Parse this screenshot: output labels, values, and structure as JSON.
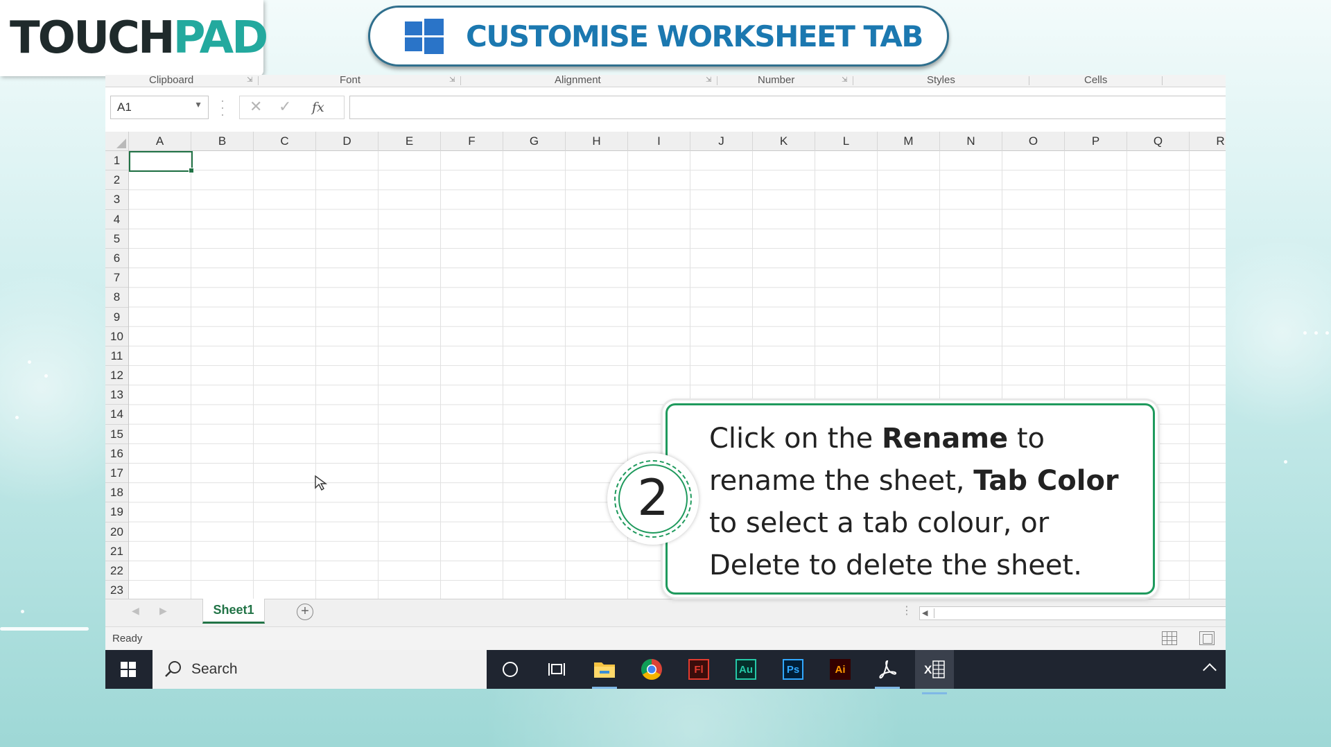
{
  "brand": {
    "logo_part1": "TOUCH",
    "logo_part2": "PAD",
    "accent": "#23a99e",
    "dark": "#1f2a2b"
  },
  "title": {
    "text": "CUSTOMISE WORKSHEET TAB",
    "color": "#1b78b0",
    "icon": "windows-logo-icon"
  },
  "ribbon": {
    "groups": [
      "Clipboard",
      "Font",
      "Alignment",
      "Number",
      "Styles",
      "Cells"
    ]
  },
  "formula_bar": {
    "name_box": "A1",
    "cancel_glyph": "✕",
    "enter_glyph": "✓",
    "fx_glyph": "fx",
    "formula_value": ""
  },
  "grid": {
    "columns": [
      "A",
      "B",
      "C",
      "D",
      "E",
      "F",
      "G",
      "H",
      "I",
      "J",
      "K",
      "L",
      "M",
      "N",
      "O",
      "P",
      "Q",
      "R"
    ],
    "rows": [
      "1",
      "2",
      "3",
      "4",
      "5",
      "6",
      "7",
      "8",
      "9",
      "10",
      "11",
      "12",
      "13",
      "14",
      "15",
      "16",
      "17",
      "18",
      "19",
      "20",
      "21",
      "22",
      "23"
    ],
    "active_cell": "A1",
    "grid_color": "#217346"
  },
  "sheet_tabs": {
    "tabs": [
      "Sheet1"
    ],
    "active": "Sheet1",
    "add_glyph": "+"
  },
  "status_bar": {
    "text": "Ready"
  },
  "taskbar": {
    "search_placeholder": "Search",
    "apps": [
      {
        "label": "Fl",
        "color": "#e33b2e",
        "bg": "#3b0d0b"
      },
      {
        "label": "Au",
        "color": "#25c9a8",
        "bg": "#052e2a"
      },
      {
        "label": "Ps",
        "color": "#31a8ff",
        "bg": "#001e36"
      },
      {
        "label": "Ai",
        "color": "#ff9a00",
        "bg": "#330000"
      }
    ],
    "excel_label": "X"
  },
  "callout": {
    "step_number": "2",
    "pre": "Click on the ",
    "rename": "Rename",
    "mid1": " to rename the sheet, ",
    "tab_color": "Tab Color",
    "mid2": " to select a tab colour, or Delete to delete the sheet.",
    "border_color": "#1f9a5d"
  }
}
